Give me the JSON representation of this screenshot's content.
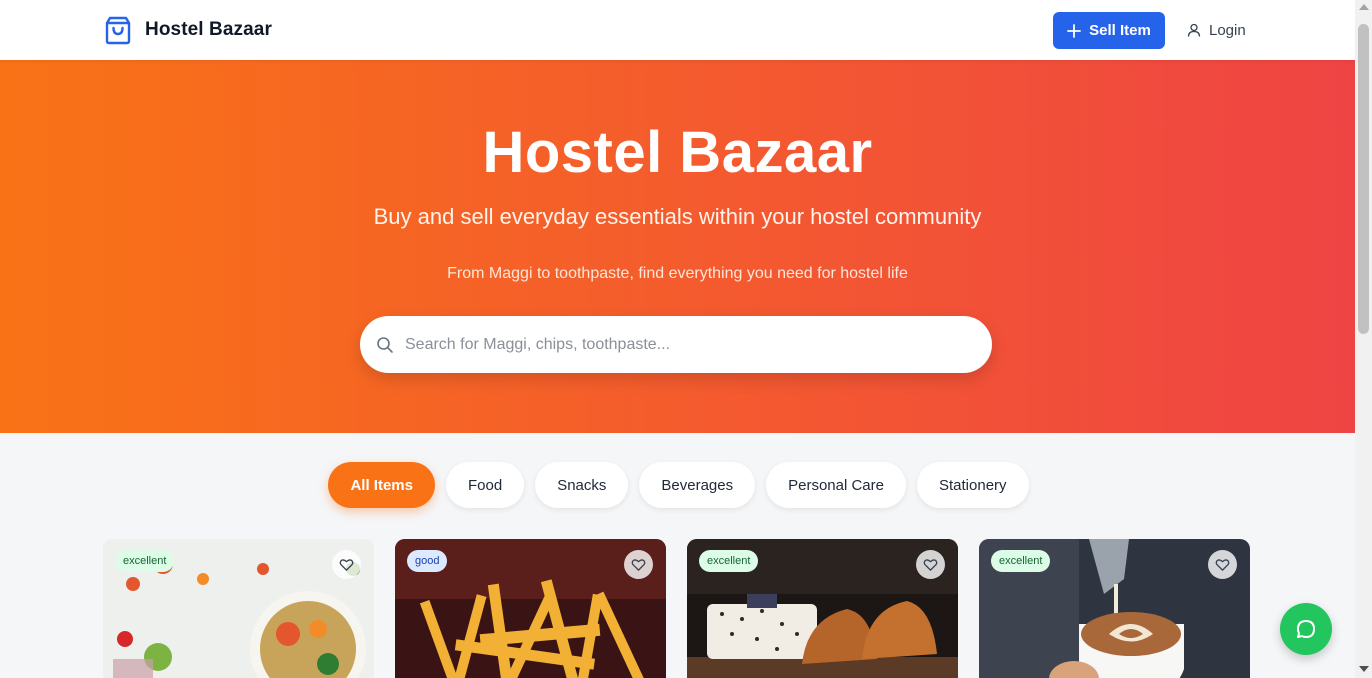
{
  "header": {
    "brand_name": "Hostel Bazaar",
    "brand_icon": "shopping-bag-icon",
    "sell_label": "Sell Item",
    "login_label": "Login"
  },
  "hero": {
    "title": "Hostel Bazaar",
    "subtitle": "Buy and sell everyday essentials within your hostel community",
    "tagline": "From Maggi to toothpaste, find everything you need for hostel life",
    "search_placeholder": "Search for Maggi, chips, toothpaste..."
  },
  "categories": [
    {
      "label": "All Items",
      "active": true
    },
    {
      "label": "Food",
      "active": false
    },
    {
      "label": "Snacks",
      "active": false
    },
    {
      "label": "Beverages",
      "active": false
    },
    {
      "label": "Personal Care",
      "active": false
    },
    {
      "label": "Stationery",
      "active": false
    }
  ],
  "cards": [
    {
      "condition": "excellent",
      "image": "salad-bowl-vegetables"
    },
    {
      "condition": "good",
      "image": "french-fries"
    },
    {
      "condition": "excellent",
      "image": "shirts-and-leather-shoes"
    },
    {
      "condition": "excellent",
      "image": "latte-art-coffee"
    }
  ],
  "colors": {
    "primary_blue": "#2563eb",
    "hero_gradient_start": "#f97316",
    "hero_gradient_end": "#ef4444",
    "active_category": "#f97316",
    "chat_green": "#22c55e"
  }
}
